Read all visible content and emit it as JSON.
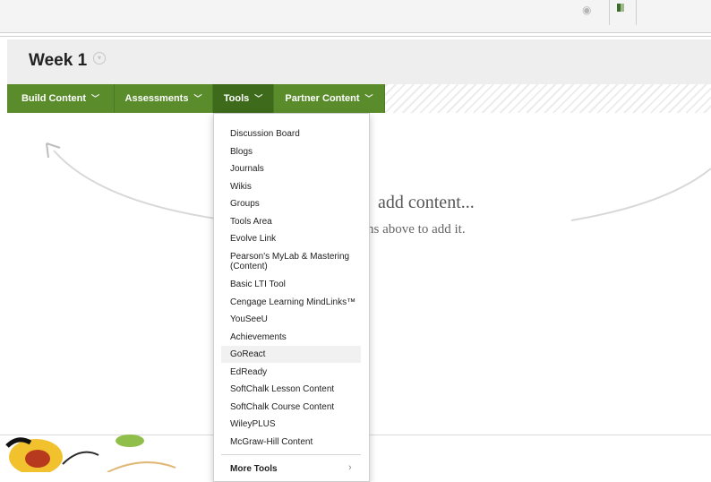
{
  "header": {
    "title": "Week 1"
  },
  "action_bar": {
    "items": [
      {
        "label": "Build Content",
        "active": false
      },
      {
        "label": "Assessments",
        "active": false
      },
      {
        "label": "Tools",
        "active": true
      },
      {
        "label": "Partner Content",
        "active": false
      }
    ]
  },
  "placeholder": {
    "main_fragment": "add content...",
    "sub_fragment": "ns above to add it."
  },
  "tools_menu": {
    "items": [
      "Discussion Board",
      "Blogs",
      "Journals",
      "Wikis",
      "Groups",
      "Tools Area",
      "Evolve Link",
      "Pearson's MyLab & Mastering (Content)",
      "Basic LTI Tool",
      "Cengage Learning MindLinks™",
      "YouSeeU",
      "Achievements",
      "GoReact",
      "EdReady",
      "SoftChalk Lesson Content",
      "SoftChalk Course Content",
      "WileyPLUS",
      "McGraw-Hill Content"
    ],
    "highlighted": "GoReact",
    "more_label": "More Tools"
  },
  "colors": {
    "menu_green": "#5a8c2c",
    "menu_green_active": "#3e6b1b"
  },
  "icons": {
    "title_menu": "chevron-down-circle-icon",
    "menu_chevron": "chevron-down-icon",
    "more_chevron": "chevron-right-icon"
  }
}
